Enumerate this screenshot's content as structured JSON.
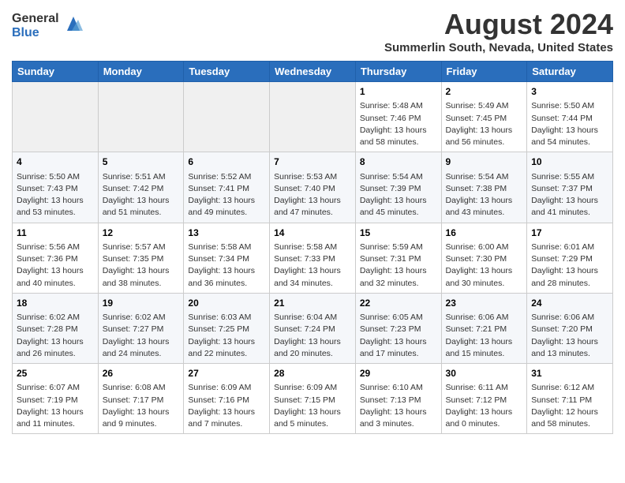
{
  "logo": {
    "general": "General",
    "blue": "Blue"
  },
  "header": {
    "month_year": "August 2024",
    "location": "Summerlin South, Nevada, United States"
  },
  "weekdays": [
    "Sunday",
    "Monday",
    "Tuesday",
    "Wednesday",
    "Thursday",
    "Friday",
    "Saturday"
  ],
  "weeks": [
    [
      {
        "day": "",
        "empty": true
      },
      {
        "day": "",
        "empty": true
      },
      {
        "day": "",
        "empty": true
      },
      {
        "day": "",
        "empty": true
      },
      {
        "day": "1",
        "sunrise": "5:48 AM",
        "sunset": "7:46 PM",
        "daylight": "13 hours and 58 minutes."
      },
      {
        "day": "2",
        "sunrise": "5:49 AM",
        "sunset": "7:45 PM",
        "daylight": "13 hours and 56 minutes."
      },
      {
        "day": "3",
        "sunrise": "5:50 AM",
        "sunset": "7:44 PM",
        "daylight": "13 hours and 54 minutes."
      }
    ],
    [
      {
        "day": "4",
        "sunrise": "5:50 AM",
        "sunset": "7:43 PM",
        "daylight": "13 hours and 53 minutes."
      },
      {
        "day": "5",
        "sunrise": "5:51 AM",
        "sunset": "7:42 PM",
        "daylight": "13 hours and 51 minutes."
      },
      {
        "day": "6",
        "sunrise": "5:52 AM",
        "sunset": "7:41 PM",
        "daylight": "13 hours and 49 minutes."
      },
      {
        "day": "7",
        "sunrise": "5:53 AM",
        "sunset": "7:40 PM",
        "daylight": "13 hours and 47 minutes."
      },
      {
        "day": "8",
        "sunrise": "5:54 AM",
        "sunset": "7:39 PM",
        "daylight": "13 hours and 45 minutes."
      },
      {
        "day": "9",
        "sunrise": "5:54 AM",
        "sunset": "7:38 PM",
        "daylight": "13 hours and 43 minutes."
      },
      {
        "day": "10",
        "sunrise": "5:55 AM",
        "sunset": "7:37 PM",
        "daylight": "13 hours and 41 minutes."
      }
    ],
    [
      {
        "day": "11",
        "sunrise": "5:56 AM",
        "sunset": "7:36 PM",
        "daylight": "13 hours and 40 minutes."
      },
      {
        "day": "12",
        "sunrise": "5:57 AM",
        "sunset": "7:35 PM",
        "daylight": "13 hours and 38 minutes."
      },
      {
        "day": "13",
        "sunrise": "5:58 AM",
        "sunset": "7:34 PM",
        "daylight": "13 hours and 36 minutes."
      },
      {
        "day": "14",
        "sunrise": "5:58 AM",
        "sunset": "7:33 PM",
        "daylight": "13 hours and 34 minutes."
      },
      {
        "day": "15",
        "sunrise": "5:59 AM",
        "sunset": "7:31 PM",
        "daylight": "13 hours and 32 minutes."
      },
      {
        "day": "16",
        "sunrise": "6:00 AM",
        "sunset": "7:30 PM",
        "daylight": "13 hours and 30 minutes."
      },
      {
        "day": "17",
        "sunrise": "6:01 AM",
        "sunset": "7:29 PM",
        "daylight": "13 hours and 28 minutes."
      }
    ],
    [
      {
        "day": "18",
        "sunrise": "6:02 AM",
        "sunset": "7:28 PM",
        "daylight": "13 hours and 26 minutes."
      },
      {
        "day": "19",
        "sunrise": "6:02 AM",
        "sunset": "7:27 PM",
        "daylight": "13 hours and 24 minutes."
      },
      {
        "day": "20",
        "sunrise": "6:03 AM",
        "sunset": "7:25 PM",
        "daylight": "13 hours and 22 minutes."
      },
      {
        "day": "21",
        "sunrise": "6:04 AM",
        "sunset": "7:24 PM",
        "daylight": "13 hours and 20 minutes."
      },
      {
        "day": "22",
        "sunrise": "6:05 AM",
        "sunset": "7:23 PM",
        "daylight": "13 hours and 17 minutes."
      },
      {
        "day": "23",
        "sunrise": "6:06 AM",
        "sunset": "7:21 PM",
        "daylight": "13 hours and 15 minutes."
      },
      {
        "day": "24",
        "sunrise": "6:06 AM",
        "sunset": "7:20 PM",
        "daylight": "13 hours and 13 minutes."
      }
    ],
    [
      {
        "day": "25",
        "sunrise": "6:07 AM",
        "sunset": "7:19 PM",
        "daylight": "13 hours and 11 minutes."
      },
      {
        "day": "26",
        "sunrise": "6:08 AM",
        "sunset": "7:17 PM",
        "daylight": "13 hours and 9 minutes."
      },
      {
        "day": "27",
        "sunrise": "6:09 AM",
        "sunset": "7:16 PM",
        "daylight": "13 hours and 7 minutes."
      },
      {
        "day": "28",
        "sunrise": "6:09 AM",
        "sunset": "7:15 PM",
        "daylight": "13 hours and 5 minutes."
      },
      {
        "day": "29",
        "sunrise": "6:10 AM",
        "sunset": "7:13 PM",
        "daylight": "13 hours and 3 minutes."
      },
      {
        "day": "30",
        "sunrise": "6:11 AM",
        "sunset": "7:12 PM",
        "daylight": "13 hours and 0 minutes."
      },
      {
        "day": "31",
        "sunrise": "6:12 AM",
        "sunset": "7:11 PM",
        "daylight": "12 hours and 58 minutes."
      }
    ]
  ],
  "labels": {
    "sunrise": "Sunrise: ",
    "sunset": "Sunset: ",
    "daylight": "Daylight: "
  }
}
